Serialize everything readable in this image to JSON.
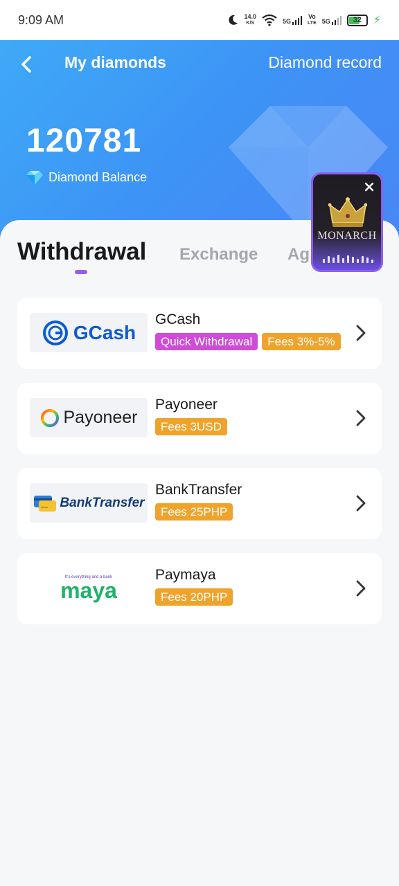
{
  "status_bar": {
    "time": "9:09 AM",
    "speed_value": "14.0",
    "speed_unit": "K/S",
    "net1": "5G",
    "volte_top": "Vo",
    "volte_bottom": "LTE",
    "net2": "5G",
    "battery": "32",
    "icons": [
      "moon-icon",
      "wifi-icon",
      "signal-icon",
      "battery-icon",
      "charging-bolt-icon"
    ]
  },
  "header": {
    "title": "My diamonds",
    "record_link": "Diamond record",
    "balance": "120781",
    "balance_label": "Diamond Balance",
    "gradient_start": "#3eaaf6",
    "gradient_end": "#4a86f5"
  },
  "tabs": {
    "items": [
      "Withdrawal",
      "Exchange",
      "Ag"
    ],
    "active": "Withdrawal",
    "indicator_color": "#9b5cf0"
  },
  "methods": [
    {
      "name": "GCash",
      "logo_text": "GCash",
      "tags": [
        "Quick Withdrawal",
        "Fees 3%-5%"
      ]
    },
    {
      "name": "Payoneer",
      "logo_text": "Payoneer",
      "tags": [
        "Fees 3USD"
      ]
    },
    {
      "name": "BankTransfer",
      "logo_text": "BankTransfer",
      "tags": [
        "Fees 25PHP"
      ]
    },
    {
      "name": "Paymaya",
      "logo_text": "maya",
      "logo_subtext": "It's everything and a bank",
      "tags": [
        "Fees 20PHP"
      ]
    }
  ],
  "floating_widget": {
    "title": "MONARCH"
  },
  "colors": {
    "tag_quick": "#d04cd8",
    "tag_fee": "#f0a32a",
    "gcash_blue": "#0b5bd3",
    "maya_green": "#1fb36c"
  }
}
